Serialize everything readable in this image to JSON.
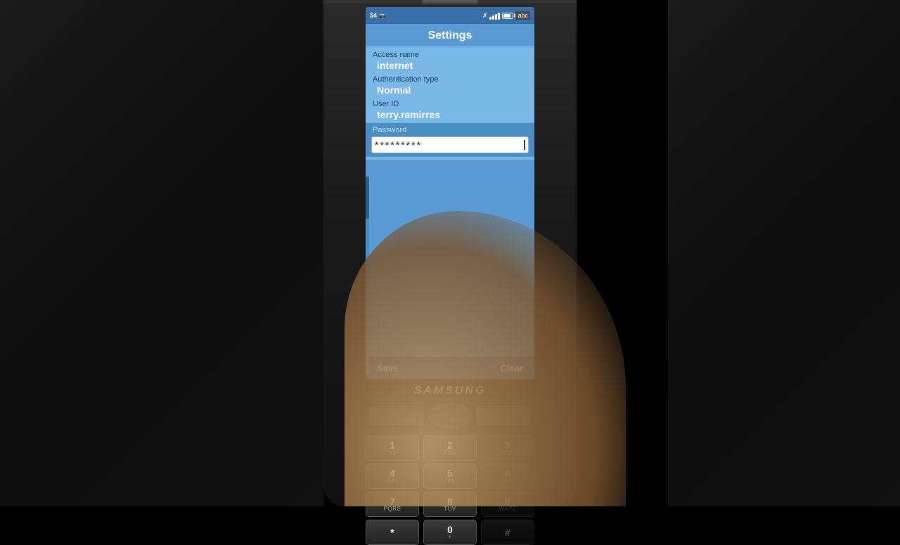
{
  "phone": {
    "brand": "SAMSUNG",
    "status": {
      "signal_level": "54",
      "signal_bars": 4,
      "battery_label": "abc",
      "network_icon": "X"
    },
    "screen": {
      "title": "Settings",
      "fields": [
        {
          "label": "Access name",
          "value": "internet"
        },
        {
          "label": "Authentication type",
          "value": "Normal"
        },
        {
          "label": "User ID",
          "value": "terry.ramirres"
        }
      ],
      "password_label": "Password",
      "password_value": "*********",
      "actions": {
        "save": "Save",
        "clear": "Clear"
      }
    },
    "keypad": {
      "rows": [
        [
          {
            "number": "1",
            "letters": "σο"
          },
          {
            "number": "2",
            "letters": "ABC"
          },
          {
            "number": "3",
            "letters": "DEF"
          }
        ],
        [
          {
            "number": "4",
            "letters": "GHI"
          },
          {
            "number": "5",
            "letters": "JKL"
          },
          {
            "number": "6",
            "letters": "MNO"
          }
        ],
        [
          {
            "number": "7",
            "letters": "PQRS"
          },
          {
            "number": "8",
            "letters": "TUV"
          },
          {
            "number": "9",
            "letters": "WXYZ"
          }
        ],
        [
          {
            "number": "*",
            "letters": ""
          },
          {
            "number": "0",
            "letters": "+"
          },
          {
            "number": "#",
            "letters": ""
          }
        ]
      ]
    }
  }
}
